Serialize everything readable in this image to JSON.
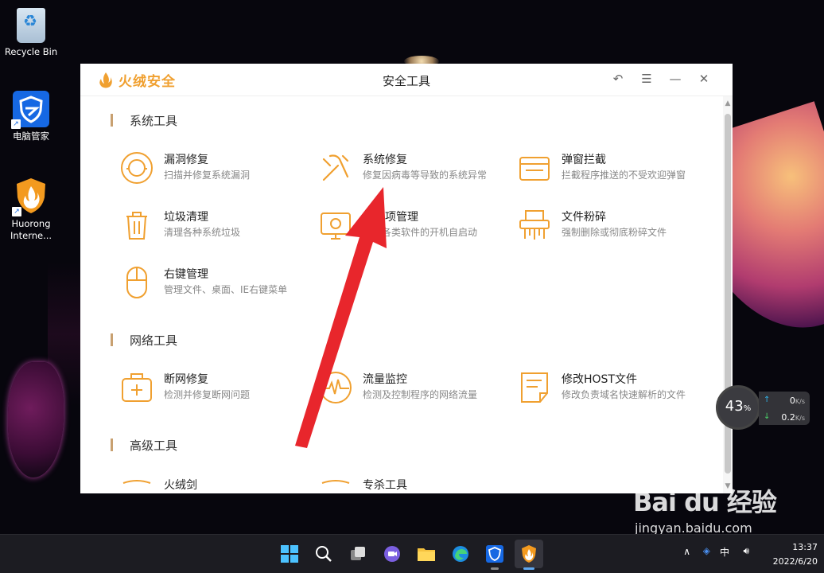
{
  "desktop": {
    "icons": [
      {
        "label": "Recycle Bin"
      },
      {
        "label": "电脑管家"
      },
      {
        "label": "Huorong Interne..."
      }
    ]
  },
  "window": {
    "brand": "火绒安全",
    "title": "安全工具",
    "controls": {
      "back_icon": "↶",
      "menu_icon": "☰",
      "minimize_icon": "—",
      "close_icon": "✕"
    },
    "sections": [
      {
        "title": "系统工具",
        "tools": [
          {
            "name": "漏洞修复",
            "desc": "扫描并修复系统漏洞",
            "icon": "vulnerability-fix-icon"
          },
          {
            "name": "系统修复",
            "desc": "修复因病毒等导致的系统异常",
            "icon": "system-repair-icon"
          },
          {
            "name": "弹窗拦截",
            "desc": "拦截程序推送的不受欢迎弹窗",
            "icon": "popup-block-icon"
          },
          {
            "name": "启动项管理",
            "desc": "管理各类软件的开机自启动",
            "icon": "startup-manage-icon"
          },
          {
            "name": "垃圾清理",
            "desc": "清理各种系统垃圾",
            "icon": "trash-clean-icon"
          },
          {
            "name": "文件粉碎",
            "desc": "强制删除或彻底粉碎文件",
            "icon": "file-shred-icon"
          },
          {
            "name": "右键管理",
            "desc": "管理文件、桌面、IE右键菜单",
            "icon": "mouse-icon"
          }
        ]
      },
      {
        "title": "网络工具",
        "tools": [
          {
            "name": "断网修复",
            "desc": "检测并修复断网问题",
            "icon": "network-repair-icon"
          },
          {
            "name": "流量监控",
            "desc": "检测及控制程序的网络流量",
            "icon": "traffic-monitor-icon"
          },
          {
            "name": "修改HOST文件",
            "desc": "修改负责域名快速解析的文件",
            "icon": "host-file-icon"
          }
        ]
      },
      {
        "title": "高级工具",
        "tools": [
          {
            "name": "火绒剑",
            "desc": "",
            "icon": "sword-icon"
          },
          {
            "name": "专杀工具",
            "desc": "",
            "icon": "special-kill-icon"
          }
        ]
      }
    ]
  },
  "netmon": {
    "percent": "43",
    "percent_unit": "%",
    "up": "0",
    "down": "0.2",
    "unit": "K/s"
  },
  "tray": {
    "time": "13:37",
    "date": "2022/6/20",
    "ime": "中"
  },
  "watermark": {
    "main": "Bai du 经验",
    "sub": "jingyan.baidu.com"
  },
  "colors": {
    "accent": "#f0a030",
    "section_bar": "#c8a070",
    "arrow": "#e8262c"
  }
}
